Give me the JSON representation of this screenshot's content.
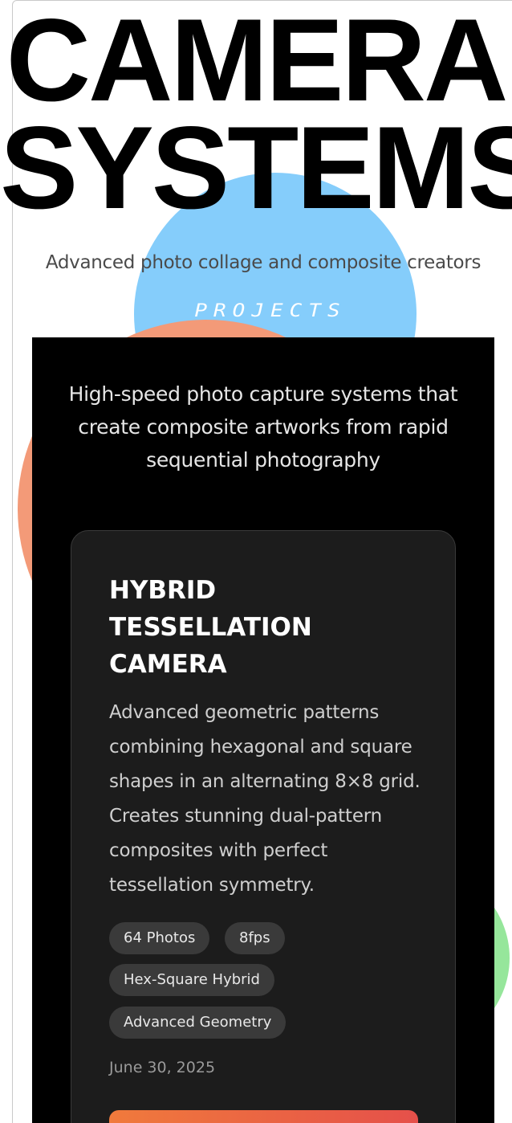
{
  "colors": {
    "blob_blue": "#85cdfb",
    "blob_orange": "#f39a78",
    "blob_green": "#96e69b",
    "panel_bg": "#000000",
    "card_bg": "#1c1c1c",
    "tag_bg": "#3a3a3a",
    "button_gradient_start": "#f07a3c",
    "button_gradient_end": "#e5504a"
  },
  "hero": {
    "title_line1": "CAMERA",
    "title_line2": "SYSTEMS",
    "subtitle": "Advanced photo collage and composite creators"
  },
  "section": {
    "label": "PROJECTS",
    "description": "High-speed photo capture systems that create composite artworks from rapid sequential photography"
  },
  "card": {
    "title_line1": "HYBRID",
    "title_line2": "TESSELLATION",
    "title_line3": "CAMERA",
    "description": "Advanced geometric patterns combining hexagonal and square shapes in an alternating 8×8 grid. Creates stunning dual-pattern composites with perfect tessellation symmetry.",
    "tags": [
      "64 Photos",
      "8fps",
      "Hex-Square Hybrid",
      "Advanced Geometry"
    ],
    "date": "June 30, 2025"
  }
}
